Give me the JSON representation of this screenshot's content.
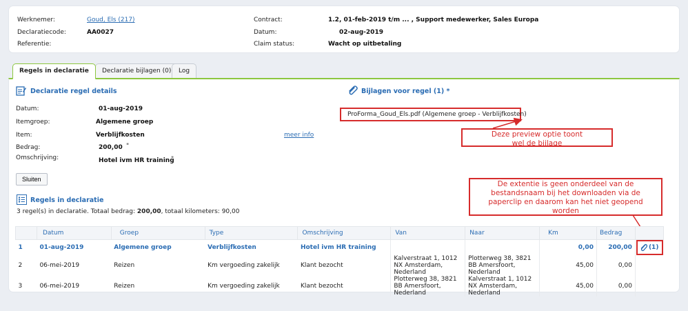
{
  "header": {
    "werknemer_label": "Werknemer:",
    "werknemer_value": "Goud, Els (217)",
    "declaratiecode_label": "Declaratiecode:",
    "declaratiecode_value": "AA0027",
    "referentie_label": "Referentie:",
    "contract_label": "Contract:",
    "contract_value": "1.2, 01-feb-2019 t/m ... , Support medewerker, Sales Europa",
    "datum_label": "Datum:",
    "datum_value": "02-aug-2019",
    "claim_label": "Claim status:",
    "claim_value": "Wacht op uitbetaling"
  },
  "tabs": [
    {
      "label": "Regels in declaratie"
    },
    {
      "label": "Declaratie bijlagen (0)"
    },
    {
      "label": "Log"
    }
  ],
  "details": {
    "title": "Declaratie regel details",
    "datum_label": "Datum:",
    "datum_value": "01-aug-2019",
    "itemgroep_label": "Itemgroep:",
    "itemgroep_value": "Algemene groep",
    "item_label": "Item:",
    "item_value": "Verblijfkosten",
    "meer_info": "meer info",
    "bedrag_label": "Bedrag:",
    "bedrag_value": "200,00",
    "bedrag_mark": "\"",
    "omschrijving_label": "Omschrijving:",
    "omschrijving_value": "Hotel ivm HR training",
    "omschrijving_mark": "\"",
    "close_button": "Sluiten"
  },
  "attachments": {
    "title": "Bijlagen voor regel (1) *",
    "file": "ProForma_Goud_Els.pdf (Algemene groep - Verblijfkosten)"
  },
  "annotations": {
    "preview_note": "Deze preview optie toont wel de bijlage",
    "extension_note": "De extentie is geen onderdeel van de bestandsnaam bij het downloaden via de paperclip en daarom kan het niet geopend worden"
  },
  "lines": {
    "title": "Regels in declaratie",
    "summary": "3 regel(s) in declaratie. Totaal bedrag: 200,00, totaal kilometers: 90,00",
    "summary_pre": "3 regel(s) in declaratie. Totaal bedrag: ",
    "summary_amount": "200,00",
    "summary_post": ", totaal kilometers: 90,00",
    "columns": [
      "Datum",
      "Groep",
      "Type",
      "Omschrijving",
      "Van",
      "Naar",
      "Km",
      "Bedrag"
    ],
    "rows": [
      {
        "nr": "1",
        "datum": "01-aug-2019",
        "groep": "Algemene groep",
        "type": "Verblijfkosten",
        "omschrijving": "Hotel ivm HR training",
        "van": "",
        "naar": "",
        "km": "0,00",
        "bedrag": "200,00",
        "attachment": "(1)"
      },
      {
        "nr": "2",
        "datum": "06-mei-2019",
        "groep": "Reizen",
        "type": "Km vergoeding zakelijk",
        "omschrijving": "Klant bezocht",
        "van": "Kalverstraat 1, 1012 NX Amsterdam, Nederland",
        "naar": "Plotterweg 38, 3821 BB Amersfoort, Nederland",
        "km": "45,00",
        "bedrag": "0,00",
        "attachment": ""
      },
      {
        "nr": "3",
        "datum": "06-mei-2019",
        "groep": "Reizen",
        "type": "Km vergoeding zakelijk",
        "omschrijving": "Klant bezocht",
        "van": "Plotterweg 38, 3821 BB Amersfoort, Nederland",
        "naar": "Kalverstraat 1, 1012 NX Amsterdam, Nederland",
        "km": "45,00",
        "bedrag": "0,00",
        "attachment": ""
      }
    ]
  },
  "colors": {
    "accent_blue": "#2a6cb3",
    "tab_green": "#8cc63e",
    "annotation_red": "#d62b2b"
  },
  "icons": [
    "document-edit-icon",
    "paperclip-icon",
    "list-icon",
    "close-quote-icon"
  ]
}
